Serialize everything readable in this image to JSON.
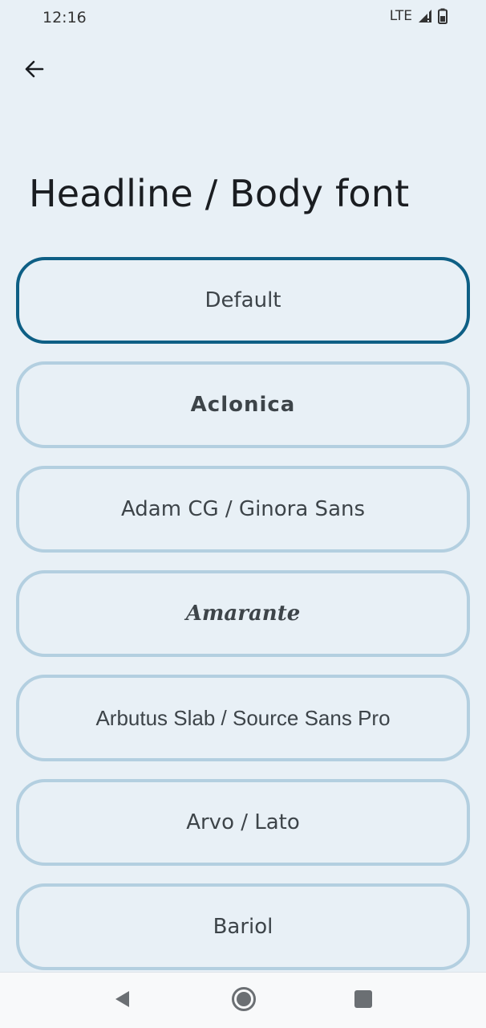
{
  "status_bar": {
    "time": "12:16",
    "network": "LTE"
  },
  "header": {
    "back_icon": "arrow-left-icon",
    "title": "Headline / Body font"
  },
  "font_options": [
    {
      "label": "Default",
      "selected": true
    },
    {
      "label": "Aclonica",
      "selected": false
    },
    {
      "label": "Adam CG / Ginora Sans",
      "selected": false
    },
    {
      "label": "Amarante",
      "selected": false
    },
    {
      "label": "Arbutus Slab / Source Sans Pro",
      "selected": false
    },
    {
      "label": "Arvo / Lato",
      "selected": false
    },
    {
      "label": "Bariol",
      "selected": false
    }
  ],
  "nav_bar": {
    "back_icon": "triangle-back-icon",
    "home_icon": "circle-home-icon",
    "recents_icon": "square-recents-icon"
  },
  "colors": {
    "background": "#e8f0f6",
    "option_border": "#b3cfe0",
    "selected_border": "#0e5f85",
    "text": "#3d4449"
  }
}
